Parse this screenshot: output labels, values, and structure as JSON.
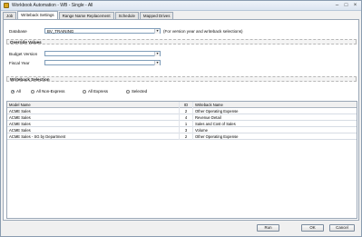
{
  "window": {
    "title": "Workbook Automation - WB - Single - All"
  },
  "tabs": [
    {
      "label": "Job"
    },
    {
      "label": "Writeback Settings"
    },
    {
      "label": "Range Name Replacement"
    },
    {
      "label": "Schedule"
    },
    {
      "label": "Mapped Drives"
    }
  ],
  "settings": {
    "database_label": "Database",
    "database_value": "BV_TRAINING",
    "database_hint": "(For version year and writeback selections)",
    "override_section": "Override Values",
    "budget_version_label": "Budget Version",
    "budget_version_value": "",
    "fiscal_year_label": "Fiscal Year",
    "fiscal_year_value": "",
    "writeback_section": "Writeback Selection",
    "radio_options": [
      {
        "label": "All",
        "selected": true
      },
      {
        "label": "All Non-Express",
        "selected": false
      },
      {
        "label": "All Express",
        "selected": false
      },
      {
        "label": "Selected",
        "selected": false
      }
    ]
  },
  "table": {
    "columns": [
      "Model Name",
      "ID",
      "Writeback Name"
    ],
    "rows": [
      {
        "model": "ACME Sales",
        "id": "2",
        "writeback": "Other Operating Expense"
      },
      {
        "model": "ACME Sales",
        "id": "4",
        "writeback": "Revenue Detail"
      },
      {
        "model": "ACME Sales",
        "id": "1",
        "writeback": "Sales and Cost of Sales"
      },
      {
        "model": "ACME Sales",
        "id": "3",
        "writeback": "Volume"
      },
      {
        "model": "ACME Sales - SG by Department",
        "id": "2",
        "writeback": "Other Operating Expense"
      }
    ]
  },
  "buttons": {
    "run": "Run",
    "ok": "OK",
    "cancel": "Cancel"
  }
}
